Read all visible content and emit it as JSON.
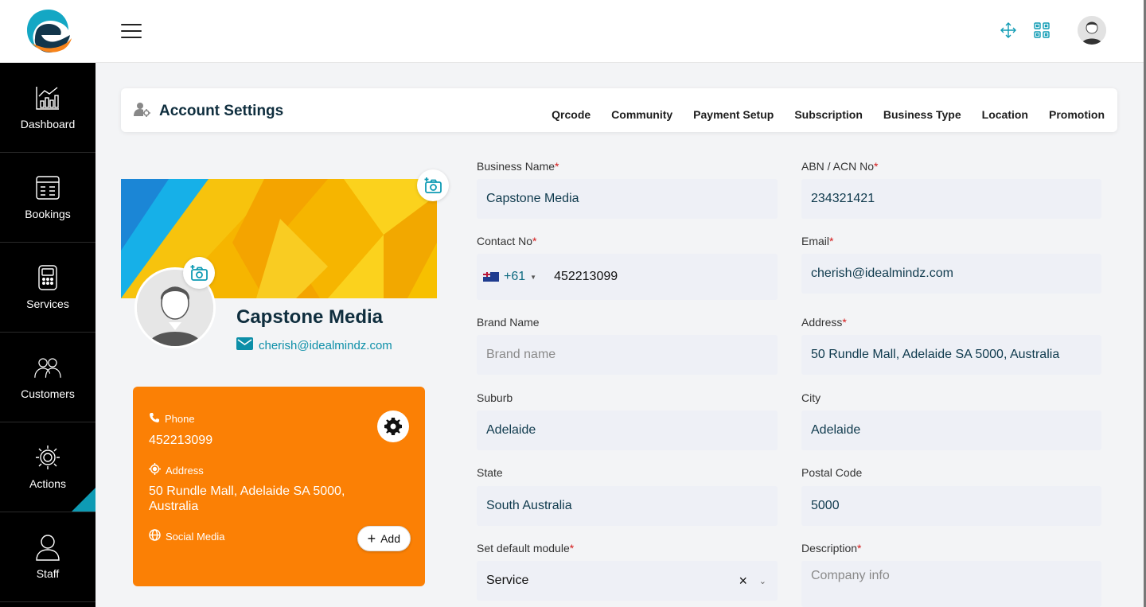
{
  "header": {
    "icons": [
      "menu-icon",
      "fullscreen-icon",
      "qrcode-icon",
      "user-avatar"
    ]
  },
  "sidebar": {
    "items": [
      {
        "label": "Dashboard",
        "icon": "chart-icon"
      },
      {
        "label": "Bookings",
        "icon": "bookings-icon"
      },
      {
        "label": "Services",
        "icon": "services-icon"
      },
      {
        "label": "Customers",
        "icon": "customers-icon"
      },
      {
        "label": "Actions",
        "icon": "gear-icon"
      },
      {
        "label": "Staff",
        "icon": "staff-icon"
      }
    ],
    "active": "Actions"
  },
  "account": {
    "title": "Account Settings",
    "tabs": [
      "Qrcode",
      "Community",
      "Payment Setup",
      "Subscription",
      "Business Type",
      "Location",
      "Promotion"
    ]
  },
  "profile": {
    "name": "Capstone Media",
    "email": "cherish@idealmindz.com",
    "phone_label": "Phone",
    "phone": "452213099",
    "address_label": "Address",
    "address": "50 Rundle Mall, Adelaide SA 5000, Australia",
    "social_label": "Social Media",
    "add_label": "Add",
    "accent": "#fb8005"
  },
  "form": {
    "business_name": {
      "label": "Business Name",
      "value": "Capstone Media"
    },
    "abn": {
      "label": "ABN / ACN No",
      "value": "234321421"
    },
    "contact": {
      "label": "Contact No",
      "country_code": "+61",
      "value": "452213099"
    },
    "email": {
      "label": "Email",
      "value": "cherish@idealmindz.com"
    },
    "brand": {
      "label": "Brand Name",
      "placeholder": "Brand name"
    },
    "address": {
      "label": "Address",
      "value": "50 Rundle Mall, Adelaide SA 5000, Australia"
    },
    "suburb": {
      "label": "Suburb",
      "value": "Adelaide"
    },
    "city": {
      "label": "City",
      "value": "Adelaide"
    },
    "state": {
      "label": "State",
      "value": "South Australia"
    },
    "postal": {
      "label": "Postal Code",
      "value": "5000"
    },
    "module": {
      "label": "Set default module",
      "value": "Service",
      "clear": "×"
    },
    "description": {
      "label": "Description",
      "placeholder": "Company info"
    },
    "required_mark": "*"
  },
  "colors": {
    "brand_teal": "#0e9bb4",
    "orange": "#fb8005",
    "sidebar_bg": "#000000"
  }
}
